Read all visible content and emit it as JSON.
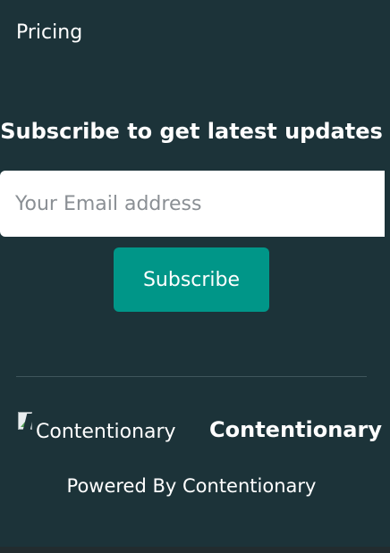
{
  "nav": {
    "pricing_label": "Pricing"
  },
  "subscribe": {
    "title": "Subscribe to get latest updates",
    "email_placeholder": "Your Email address",
    "email_value": "",
    "button_label": "Subscribe"
  },
  "brand": {
    "logo_alt_text": "Contentionary",
    "logo_icon": "broken-image-icon",
    "name": "Contentionary"
  },
  "footer": {
    "powered_by_prefix": "Powered By ",
    "powered_by_link": "Contentionary"
  },
  "colors": {
    "background": "#1c3339",
    "accent": "#009688",
    "divider": "#3f565c"
  }
}
